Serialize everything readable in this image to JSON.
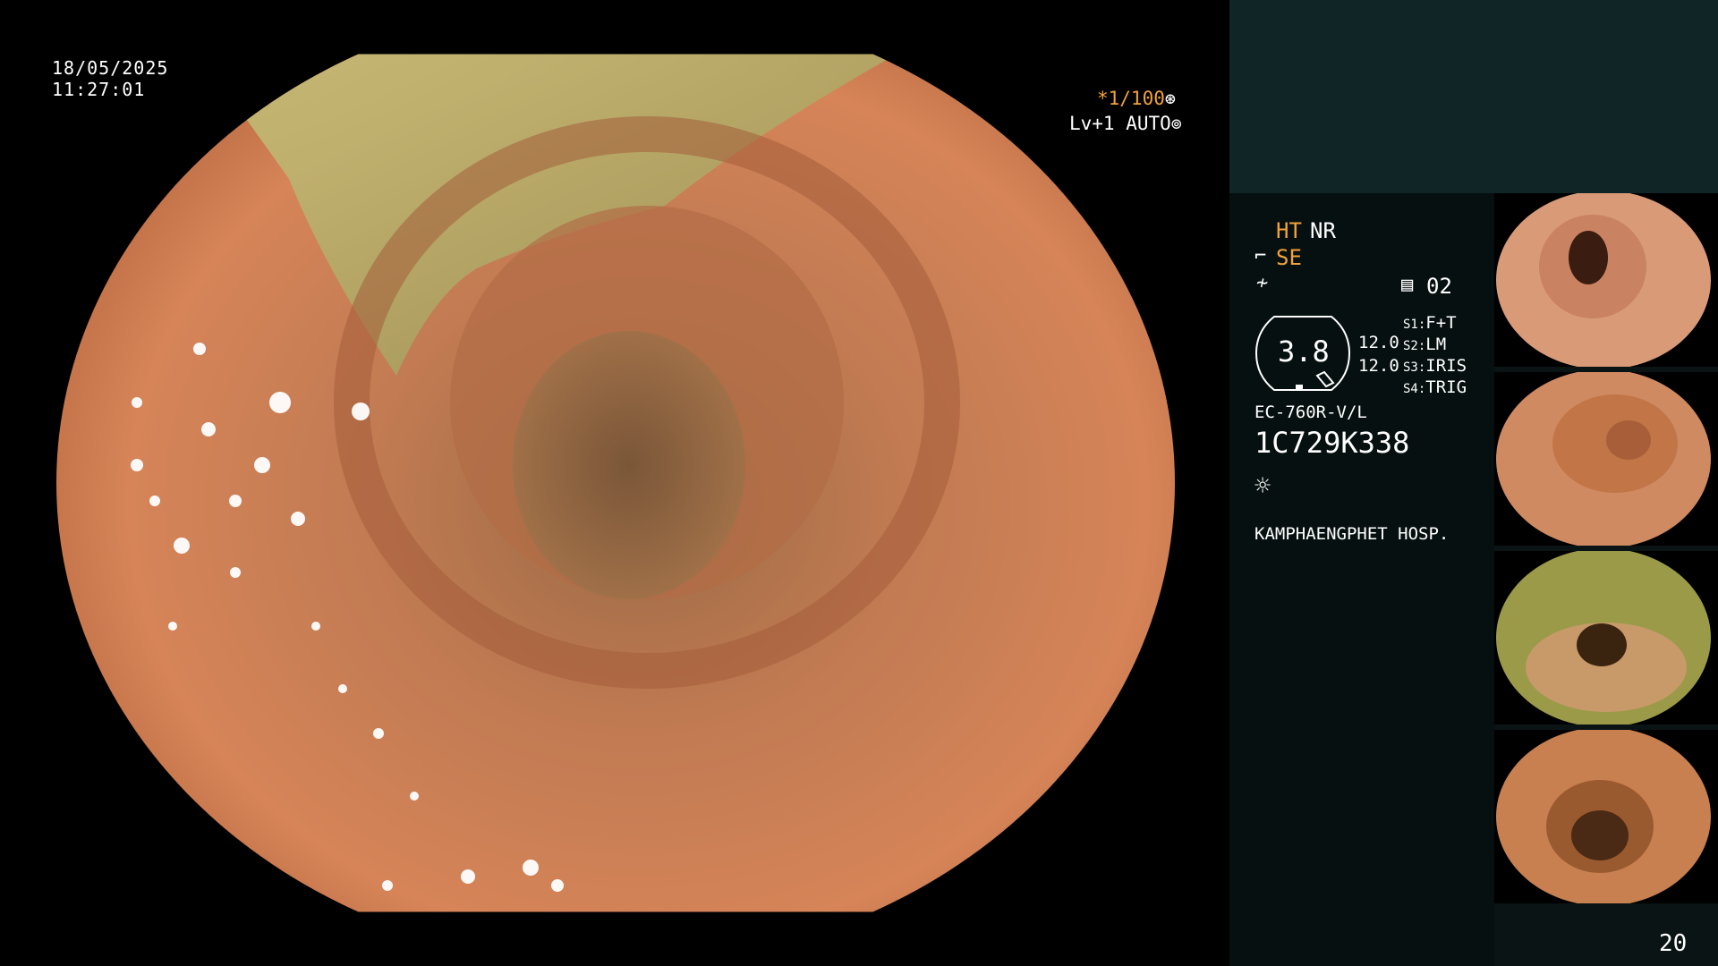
{
  "live_view": {
    "date": "18/05/2025",
    "time": "11:27:01",
    "shutter": "*1/100",
    "shutter_icon": "aperture-icon",
    "level": "Lv+1 AUTO",
    "level_icon": "iris-icon"
  },
  "panel": {
    "mode_ht": "HT",
    "mode_nr": "NR",
    "mode_se": "SE",
    "memo_count": "02",
    "zoom_value": "3.8",
    "gain_a": "12.0",
    "gain_b": "12.0",
    "slots": [
      {
        "key": "S1:",
        "value": "F+T"
      },
      {
        "key": "S2:",
        "value": "LM"
      },
      {
        "key": "S3:",
        "value": "IRIS"
      },
      {
        "key": "S4:",
        "value": "TRIG"
      }
    ],
    "scope_model": "EC-760R-V/L",
    "scope_serial": "1C729K338",
    "hospital": "KAMPHAENGPHET HOSP.",
    "page_number": "20"
  },
  "icons": {
    "se": "bracket-se-icon",
    "wave": "wave-icon",
    "memo": "memo-icon",
    "light": "light-source-icon"
  },
  "colors": {
    "accent": "#f2a23a",
    "panel_bg": "#071010",
    "panel_top": "#0f2526",
    "tissue": "#c8754a"
  }
}
